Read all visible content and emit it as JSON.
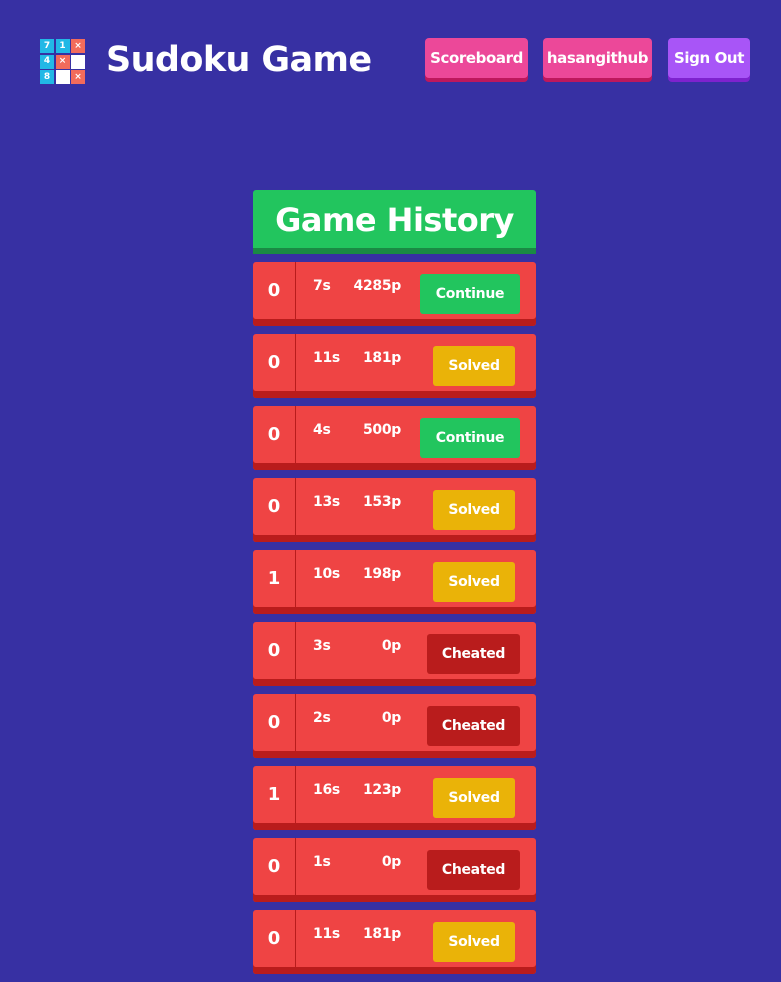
{
  "header": {
    "logo_cells": [
      "7",
      "1",
      "×",
      "4",
      "×",
      "",
      "8",
      "",
      "×"
    ],
    "title": "Sudoku Game",
    "nav": {
      "scoreboard_label": "Scoreboard",
      "user_label": "hasangithub",
      "signout_label": "Sign Out"
    }
  },
  "history": {
    "title": "Game History",
    "rows": [
      {
        "index": "0",
        "time": "7s",
        "score": "4285p",
        "status": "Continue"
      },
      {
        "index": "0",
        "time": "11s",
        "score": "181p",
        "status": "Solved"
      },
      {
        "index": "0",
        "time": "4s",
        "score": "500p",
        "status": "Continue"
      },
      {
        "index": "0",
        "time": "13s",
        "score": "153p",
        "status": "Solved"
      },
      {
        "index": "1",
        "time": "10s",
        "score": "198p",
        "status": "Solved"
      },
      {
        "index": "0",
        "time": "3s",
        "score": "0p",
        "status": "Cheated"
      },
      {
        "index": "0",
        "time": "2s",
        "score": "0p",
        "status": "Cheated"
      },
      {
        "index": "1",
        "time": "16s",
        "score": "123p",
        "status": "Solved"
      },
      {
        "index": "0",
        "time": "1s",
        "score": "0p",
        "status": "Cheated"
      },
      {
        "index": "0",
        "time": "11s",
        "score": "181p",
        "status": "Solved"
      }
    ]
  },
  "colors": {
    "background": "#3730a3",
    "header_green": "#22c55e",
    "row_red": "#ef4444",
    "continue": "#22c55e",
    "solved": "#eab308",
    "cheated": "#b91c1c",
    "nav_pink": "#ec4899",
    "nav_purple": "#a855f7"
  }
}
